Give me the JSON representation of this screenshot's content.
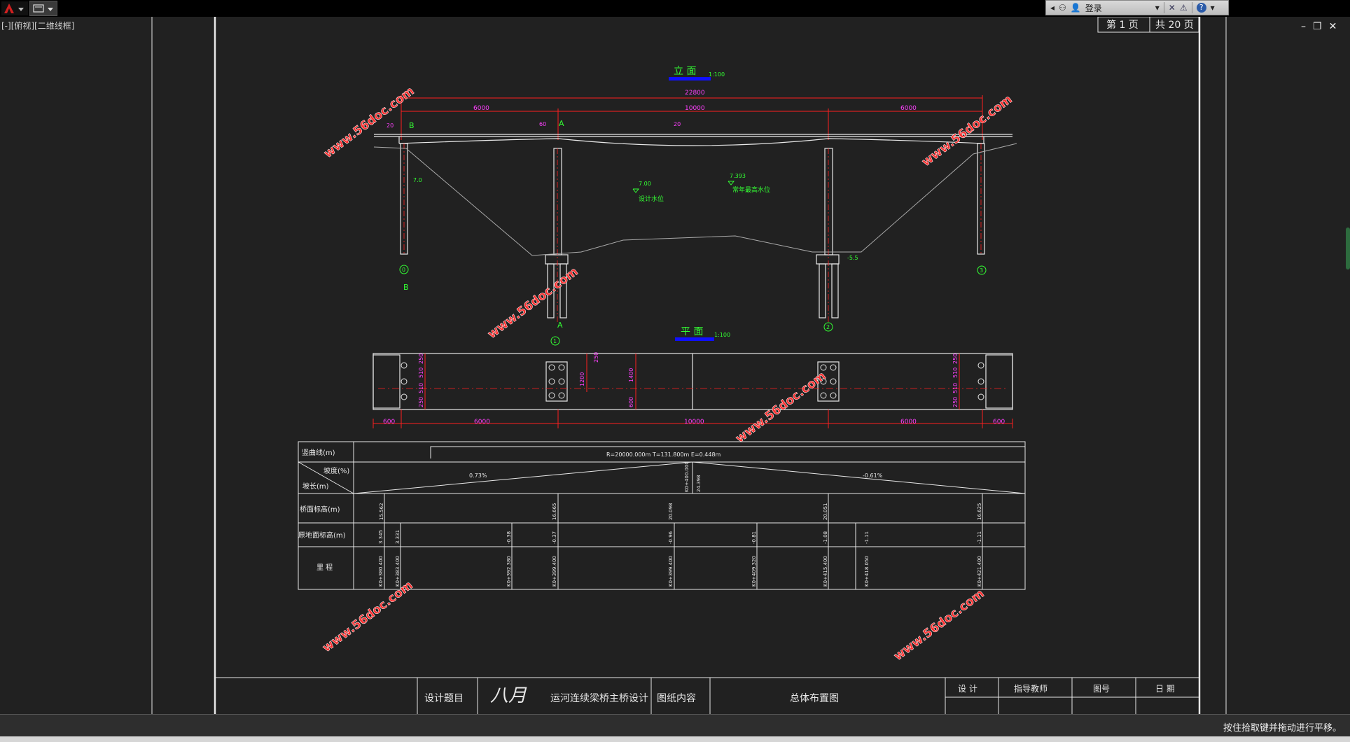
{
  "titlebar": {
    "quick_access": [
      "A",
      "≡"
    ],
    "login_label": "登录",
    "help_label": "?"
  },
  "viewport": {
    "label": "[-][俯视][二维线框]",
    "window_controls": [
      "–",
      "❐",
      "✕"
    ]
  },
  "sheet": {
    "page_current": "第 1 页",
    "page_total": "共 20 页"
  },
  "elevation": {
    "title": "立 面",
    "scale": "1:100",
    "total_len": "22800",
    "spans": [
      "6000",
      "10000",
      "6000"
    ],
    "axis_labels": [
      "A",
      "B"
    ],
    "marks": [
      "A",
      "B"
    ],
    "pier_ids": [
      "0",
      "1",
      "2",
      "3"
    ],
    "levels": [
      {
        "elev": "7.0",
        "label": ""
      },
      {
        "elev": "7.00",
        "label": "设计水位"
      },
      {
        "elev": "7.393",
        "label": "常年最高水位"
      },
      {
        "elev": "-5.5",
        "label": ""
      }
    ],
    "dims_small": [
      "20",
      "60",
      "20"
    ]
  },
  "plan": {
    "title": "平 面",
    "scale": "1:100",
    "spans": [
      "600",
      "6000",
      "10000",
      "6000",
      "600"
    ],
    "dims_vertical": [
      "1400",
      "600",
      "1200",
      "250",
      "250"
    ],
    "dims_left": [
      "250",
      "510",
      "510",
      "250"
    ],
    "dims_right": [
      "250",
      "510",
      "510",
      "250"
    ]
  },
  "profile_table": {
    "row_labels": [
      "竖曲线(m)",
      "坡度(%)",
      "坡长(m)",
      "桥面标高(m)",
      "原地面标高(m)",
      "里 程"
    ],
    "curve_text": "R=20000.000m   T=131.800m   E=0.448m",
    "slope_left": "0.73%",
    "slope_right": "-0.61%",
    "deck_levels": [
      "15.562",
      "16.665",
      "20.098",
      "20.051",
      "16.625"
    ],
    "ground_levels": [
      "3.345",
      "3.331",
      "-0.38",
      "-0.37",
      "-0.96",
      "-0.81",
      "-1.08",
      "-1.11",
      "-1.11"
    ],
    "chainages": [
      "K0+380.400",
      "K0+383.400",
      "K0+392.380",
      "K0+399.400",
      "K0+399.400",
      "K0+409.320",
      "K0+415.400",
      "K0+418.050",
      "K0+421.400"
    ],
    "vpi": [
      "K0+400.000",
      "24.398"
    ]
  },
  "titleblock": {
    "design_topic_label": "设计题目",
    "design_topic_value": "运河连续梁桥主桥设计",
    "drawing_content_label": "图纸内容",
    "drawing_content_value": "总体布置图",
    "sign_labels": [
      "设 计",
      "指导教师",
      "图号",
      "日 期"
    ],
    "handwriting": "八月"
  },
  "watermark": "www.56doc.com",
  "status": {
    "message": "按住拾取键并拖动进行平移。"
  },
  "colors": {
    "dim_red": "#ff2020",
    "text_magenta": "#ff40ff",
    "text_green": "#33ff33",
    "white": "#e8e8e8",
    "title_blue": "#1010ff",
    "background": "#212121"
  }
}
